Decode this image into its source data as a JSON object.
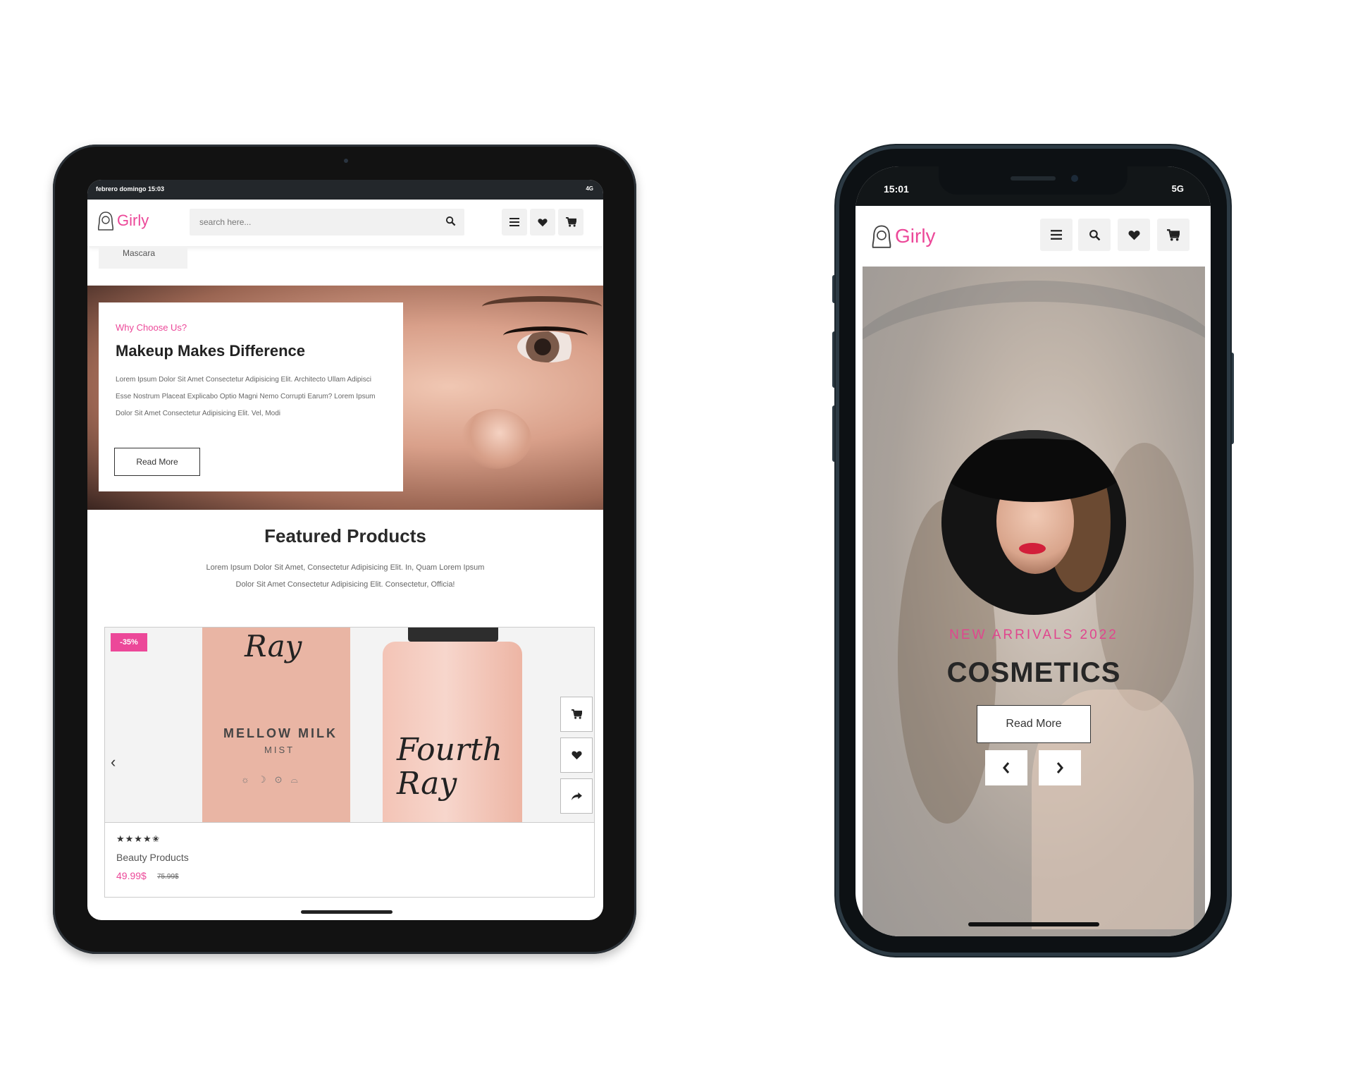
{
  "tablet": {
    "status": {
      "left": "febrero domingo 15:03",
      "right": "4G"
    },
    "logo_text": "Girly",
    "search_placeholder": "search here...",
    "dropdown_item": "Mascara",
    "hero": {
      "kicker": "Why Choose Us?",
      "title": "Makeup Makes Difference",
      "body": "Lorem Ipsum Dolor Sit Amet Consectetur Adipisicing Elit. Architecto Ullam Adipisci Esse Nostrum Placeat Explicabo Optio Magni Nemo Corrupti Earum? Lorem Ipsum Dolor Sit Amet Consectetur Adipisicing Elit. Vel, Modi",
      "button": "Read More"
    },
    "featured": {
      "title": "Featured Products",
      "desc": "Lorem Ipsum Dolor Sit Amet, Consectetur Adipisicing Elit. In, Quam Lorem Ipsum Dolor Sit Amet Consectetur Adipisicing Elit. Consectetur, Officia!"
    },
    "product": {
      "badge": "-35%",
      "box_brand": "Ray",
      "box_name": "MELLOW MILK",
      "box_sub": "MIST",
      "bottle_brand": "Fourth Ray",
      "stars": "★★★★✬",
      "name": "Beauty Products",
      "price": "49.99$",
      "old_price": "75.99$"
    }
  },
  "phone": {
    "status": {
      "time": "15:01",
      "signal": "5G"
    },
    "logo_text": "Girly",
    "hero": {
      "kicker": "NEW ARRIVALS 2022",
      "title": "COSMETICS",
      "button": "Read More"
    }
  },
  "icons": {
    "search": "search-icon",
    "menu": "menu-icon",
    "heart": "heart-icon",
    "cart": "cart-icon",
    "share": "share-icon",
    "prev": "chevron-left-icon",
    "next": "chevron-right-icon"
  },
  "colors": {
    "accent": "#ec4899",
    "dark": "#222222"
  }
}
